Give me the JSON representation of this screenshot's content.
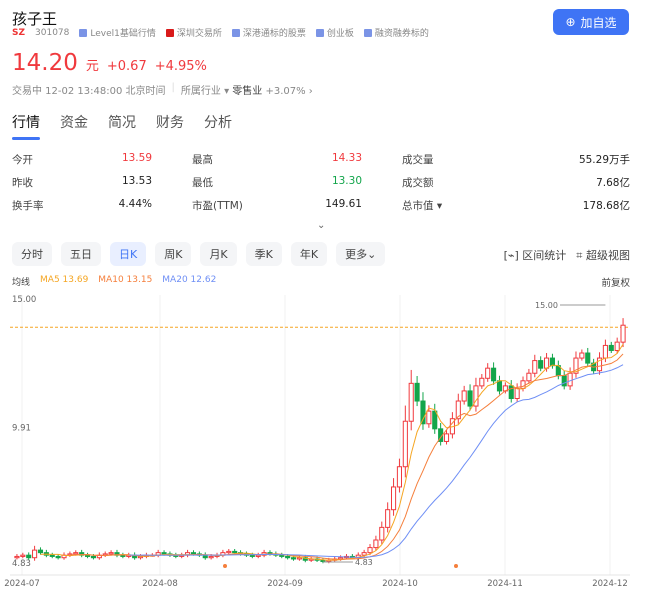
{
  "header": {
    "name": "孩子王",
    "market": "SZ",
    "code": "301078",
    "tags": [
      "Level1基础行情",
      "深圳交易所",
      "深港通标的股票",
      "创业板",
      "融资融券标的"
    ],
    "add_watch": "加自选"
  },
  "quote": {
    "price": "14.20",
    "unit": "元",
    "change": "+0.67",
    "change_pct": "+4.95%",
    "status": "交易中 12-02 13:48:00 北京时间",
    "industry_label": "所属行业",
    "industry": "零售业",
    "industry_change": "+3.07%"
  },
  "tabs": [
    "行情",
    "资金",
    "简况",
    "财务",
    "分析"
  ],
  "stats": [
    {
      "label": "今开",
      "value": "13.59",
      "color": "red"
    },
    {
      "label": "最高",
      "value": "14.33",
      "color": "red"
    },
    {
      "label": "成交量",
      "value": "55.29万手",
      "color": ""
    },
    {
      "label": "昨收",
      "value": "13.53",
      "color": ""
    },
    {
      "label": "最低",
      "value": "13.30",
      "color": "green"
    },
    {
      "label": "成交额",
      "value": "7.68亿",
      "color": ""
    },
    {
      "label": "换手率",
      "value": "4.44%",
      "color": ""
    },
    {
      "label": "市盈(TTM)",
      "value": "149.61",
      "color": ""
    },
    {
      "label": "总市值 ▾",
      "value": "178.68亿",
      "color": ""
    }
  ],
  "periods": [
    "分时",
    "五日",
    "日K",
    "周K",
    "月K",
    "季K",
    "年K",
    "更多"
  ],
  "active_period": "日K",
  "tools": {
    "range": "区间统计",
    "super": "超级视图"
  },
  "ma": {
    "label": "均线",
    "ma5": "MA5 13.69",
    "ma10": "MA10 13.15",
    "ma20": "MA20 12.62",
    "adjust": "前复权"
  },
  "colors": {
    "up": "#f0393d",
    "down": "#13a54b",
    "ma5": "#f5a623",
    "ma10": "#f57f3c",
    "ma20": "#6f8ff5",
    "accent": "#3f74f5"
  },
  "chart_data": {
    "type": "candlestick",
    "y_labels": [
      "15.00",
      "9.91",
      "4.83"
    ],
    "ylim": [
      4.83,
      15.0
    ],
    "max_label": "15.00",
    "min_label": "4.83",
    "x_labels": [
      "2024-07",
      "2024-08",
      "2024-09",
      "2024-10",
      "2024-11",
      "2024-12"
    ],
    "closes": [
      5.05,
      5.1,
      5.0,
      5.3,
      5.2,
      5.1,
      5.05,
      5.0,
      5.1,
      5.15,
      5.2,
      5.1,
      5.05,
      5.0,
      5.1,
      5.15,
      5.2,
      5.1,
      5.05,
      5.1,
      5.0,
      5.05,
      5.1,
      5.1,
      5.2,
      5.15,
      5.1,
      5.05,
      5.1,
      5.2,
      5.15,
      5.1,
      5.0,
      5.05,
      5.1,
      5.2,
      5.25,
      5.2,
      5.15,
      5.1,
      5.05,
      5.1,
      5.2,
      5.15,
      5.1,
      5.05,
      5.0,
      4.95,
      5.0,
      4.9,
      4.95,
      4.9,
      4.85,
      4.9,
      4.95,
      5.0,
      5.05,
      5.0,
      5.1,
      5.2,
      5.4,
      5.7,
      6.2,
      6.9,
      7.8,
      8.6,
      10.4,
      11.9,
      11.2,
      10.3,
      10.8,
      10.1,
      9.6,
      9.9,
      10.5,
      11.2,
      11.6,
      11.0,
      11.8,
      12.1,
      12.5,
      12.0,
      11.6,
      11.8,
      11.3,
      11.7,
      12.0,
      12.3,
      12.8,
      12.5,
      12.9,
      12.6,
      12.2,
      11.8,
      12.3,
      12.9,
      13.1,
      12.7,
      12.4,
      12.9,
      13.4,
      13.2,
      13.53,
      14.2
    ]
  }
}
